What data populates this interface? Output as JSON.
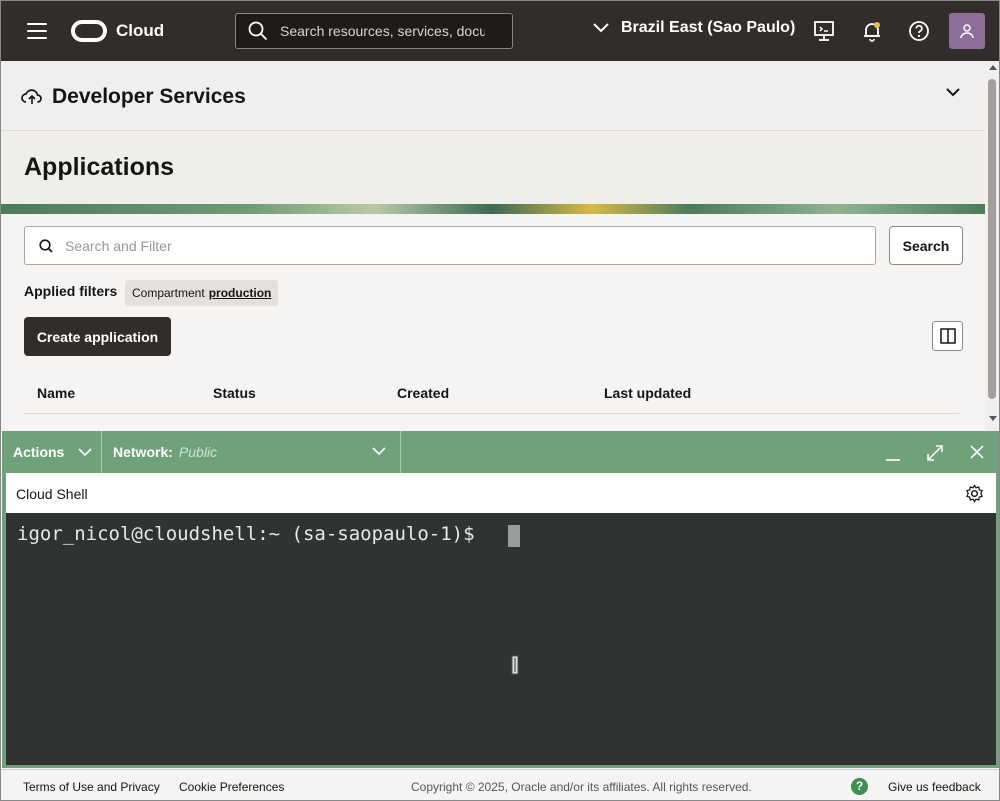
{
  "topbar": {
    "brand": "Cloud",
    "search_placeholder": "Search resources, services, documentation",
    "region": "Brazil East (Sao Paulo)"
  },
  "service": {
    "title": "Developer Services"
  },
  "page": {
    "title": "Applications",
    "filter_placeholder": "Search and Filter",
    "search_button": "Search",
    "applied_filters_label": "Applied filters",
    "chip_key": "Compartment",
    "chip_value": "production",
    "create_button": "Create application",
    "columns": [
      "Name",
      "Status",
      "Created",
      "Last updated"
    ]
  },
  "shell": {
    "actions_label": "Actions",
    "network_label": "Network:",
    "network_value": "Public",
    "title": "Cloud Shell",
    "prompt": "igor_nicol@cloudshell:~ (sa-saopaulo-1)$ "
  },
  "footer": {
    "terms": "Terms of Use and Privacy",
    "cookies": "Cookie Preferences",
    "copyright": "Copyright © 2025, Oracle and/or its affiliates. All rights reserved.",
    "help_glyph": "?",
    "feedback": "Give us feedback"
  },
  "colors": {
    "topbar": "#312d2a",
    "shell_accent": "#6fa17a",
    "terminal_bg": "#2f3331"
  }
}
